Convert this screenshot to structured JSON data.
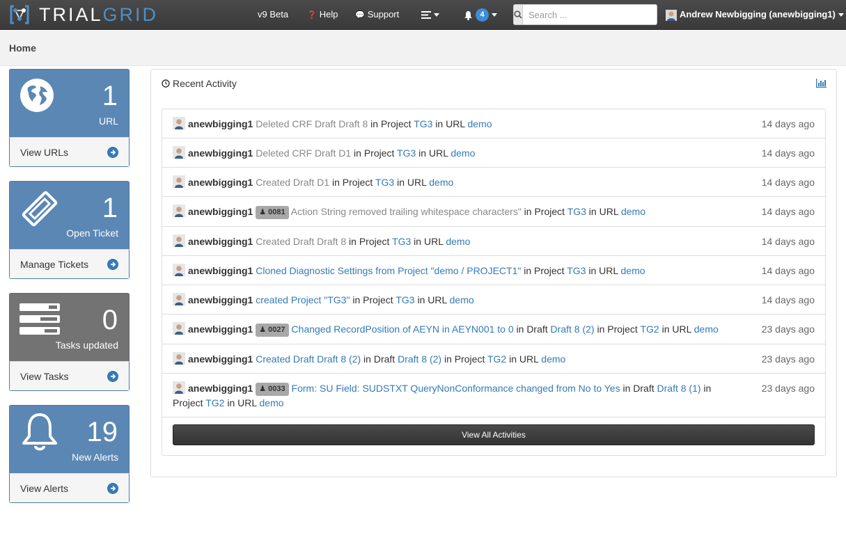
{
  "brand": {
    "part1": "TRIAL",
    "part2": "GRID"
  },
  "nav": {
    "beta": "v9 Beta",
    "help": "Help",
    "support": "Support",
    "notification_count": "4",
    "search_placeholder": "Search ...",
    "user": "Andrew Newbigging (anewbigging1)"
  },
  "page": {
    "title": "Home"
  },
  "stats": [
    {
      "number": "1",
      "label": "URL",
      "link": "View URLs",
      "icon": "globe-icon"
    },
    {
      "number": "1",
      "label": "Open Ticket",
      "link": "Manage Tickets",
      "icon": "ticket-icon"
    },
    {
      "number": "0",
      "label": "Tasks updated",
      "link": "View Tasks",
      "icon": "tasks-icon"
    },
    {
      "number": "19",
      "label": "New Alerts",
      "link": "View Alerts",
      "icon": "bell-icon"
    }
  ],
  "activity": {
    "title": "Recent Activity",
    "view_all": "View All Activities",
    "rows": [
      {
        "user": "anewbigging1",
        "action": "Deleted CRF Draft Draft 8",
        "in1": " in Project ",
        "project": "TG3",
        "in2": " in URL ",
        "url": "demo",
        "time": "14 days ago"
      },
      {
        "user": "anewbigging1",
        "action": "Deleted CRF Draft D1",
        "in1": " in Project ",
        "project": "TG3",
        "in2": " in URL ",
        "url": "demo",
        "time": "14 days ago"
      },
      {
        "user": "anewbigging1",
        "action": "Created Draft D1",
        "in1": " in Project ",
        "project": "TG3",
        "in2": " in URL ",
        "url": "demo",
        "time": "14 days ago"
      },
      {
        "user": "anewbigging1",
        "tag": "0081",
        "action": "Action String removed trailing whitespace characters\"",
        "in1": " in Project ",
        "project": "TG3",
        "in2": " in URL ",
        "url": "demo",
        "time": "14 days ago"
      },
      {
        "user": "anewbigging1",
        "action": "Created Draft Draft 8",
        "in1": " in Project ",
        "project": "TG3",
        "in2": " in URL ",
        "url": "demo",
        "time": "14 days ago"
      },
      {
        "user": "anewbigging1",
        "action": "Cloned Diagnostic Settings from Project \"demo / PROJECT1\"",
        "in1": " in Project ",
        "project": "TG3",
        "in2": " in URL ",
        "url": "demo",
        "time": "14 days ago"
      },
      {
        "user": "anewbigging1",
        "action": "created Project \"TG3\"",
        "in1": " in Project ",
        "project": "TG3",
        "in2": " in URL ",
        "url": "demo",
        "time": "14 days ago"
      },
      {
        "user": "anewbigging1",
        "tag": "0027",
        "action": "Changed RecordPosition of AEYN in AEYN001 to 0",
        "in0": " in Draft ",
        "draft": "Draft 8 (2)",
        "in1": " in Project ",
        "project": "TG2",
        "in2": " in URL ",
        "url": "demo",
        "time": "23 days ago"
      },
      {
        "user": "anewbigging1",
        "action": "Created Draft Draft 8 (2)",
        "in0": " in Draft ",
        "draft": "Draft 8 (2)",
        "in1": " in Project ",
        "project": "TG2",
        "in2": " in URL ",
        "url": "demo",
        "time": "23 days ago"
      },
      {
        "user": "anewbigging1",
        "tag": "0033",
        "action": "Form: SU Field: SUDSTXT QueryNonConformance changed from No to Yes",
        "in0": " in Draft ",
        "draft": "Draft 8 (1)",
        "in1": " in Project ",
        "project": "TG2",
        "in2": " in URL ",
        "url": "demo",
        "time": "23 days ago"
      }
    ]
  },
  "colors": {
    "accent": "#337ab7",
    "panel_blue": "#5b87b5",
    "panel_grey": "#737373",
    "navbar": "#3a3a3a"
  }
}
